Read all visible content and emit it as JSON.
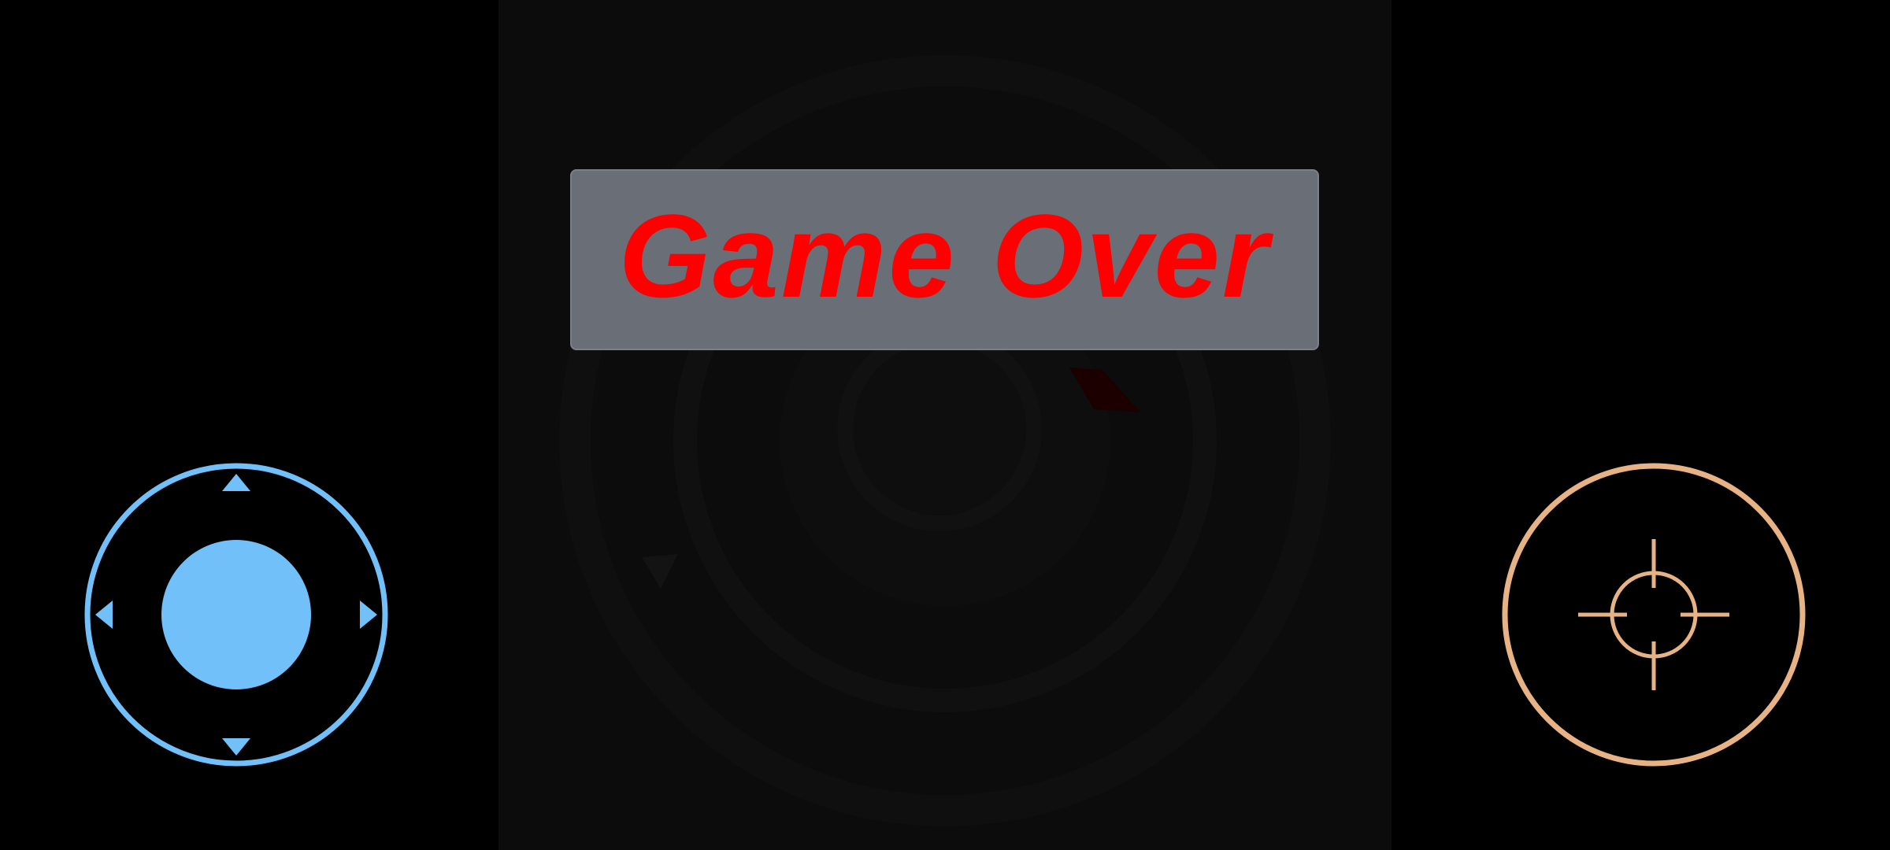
{
  "game": {
    "status_text": "Game Over",
    "status_color": "#ff0000"
  },
  "controls": {
    "joystick": {
      "icon": "dpad-joystick-icon",
      "color": "#72c0fa"
    },
    "fire_button": {
      "icon": "crosshair-icon",
      "color": "#e8b384"
    }
  },
  "colors": {
    "background": "#000000",
    "playfield": "#0c0c0c",
    "banner": "#6a6e76"
  }
}
